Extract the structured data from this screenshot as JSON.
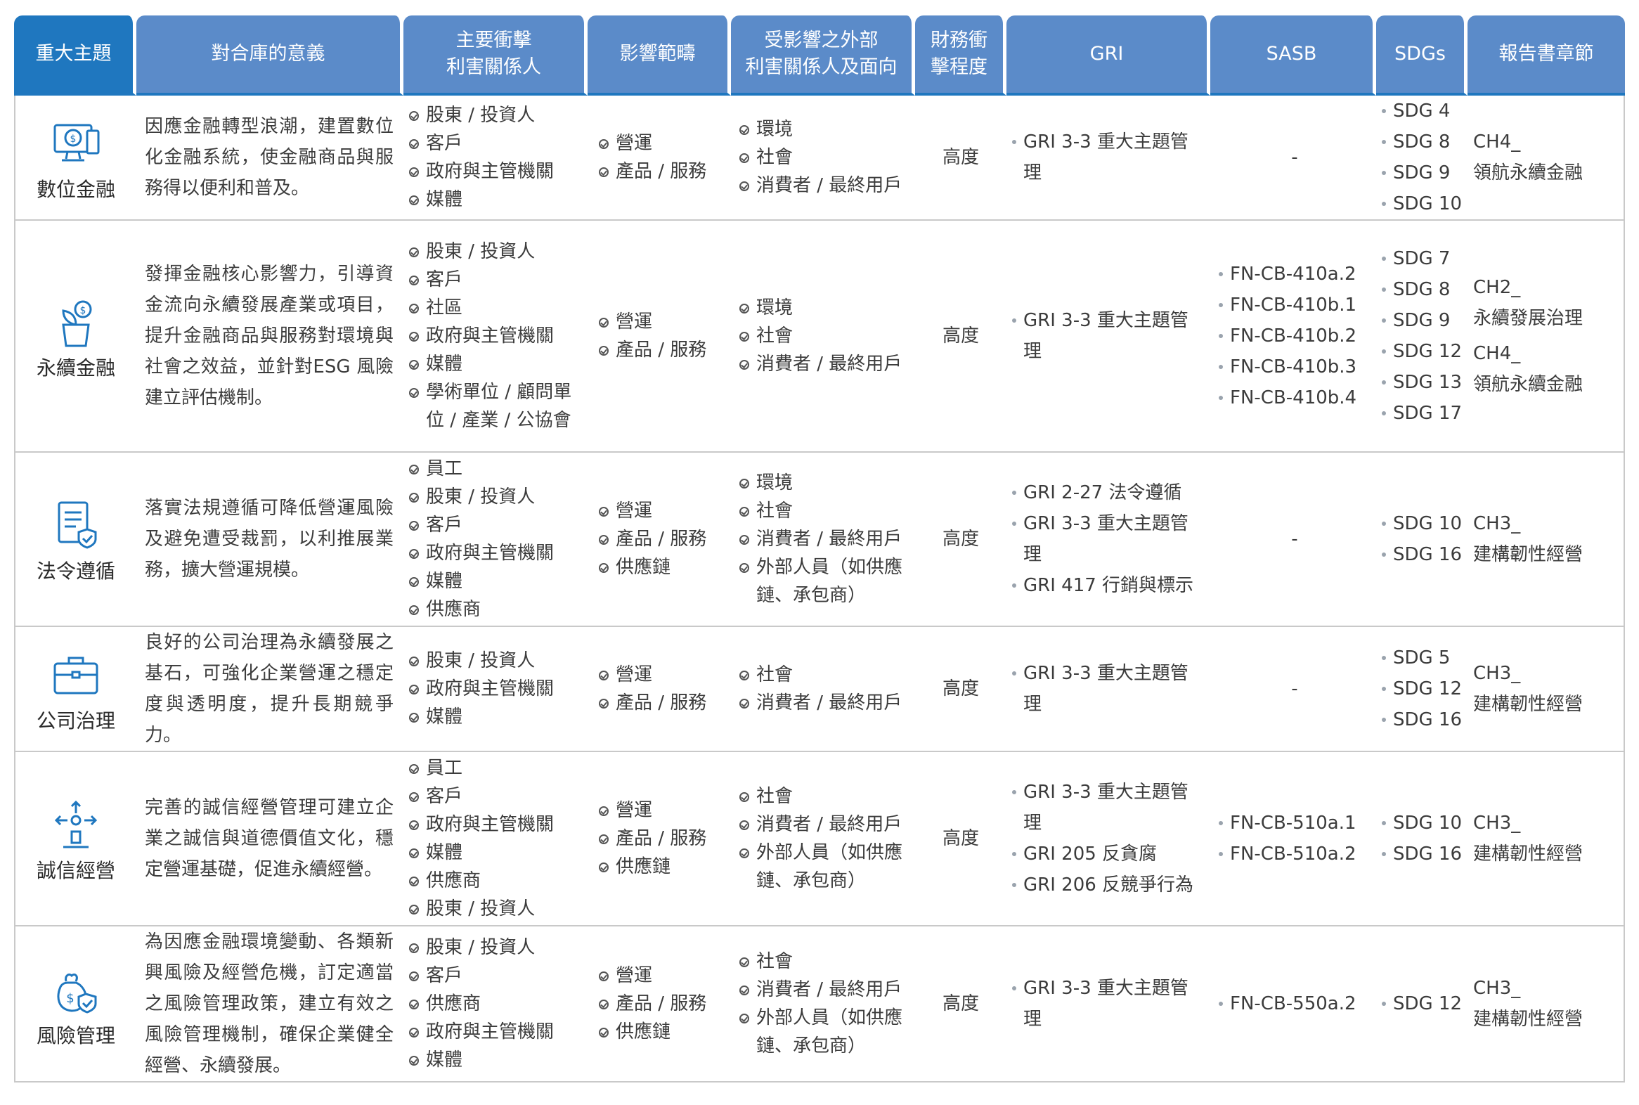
{
  "header": {
    "topic": "重大主題",
    "meaning": "對合庫的意義",
    "stakeholders": "主要衝擊\n利害關係人",
    "scope": "影響範疇",
    "external": "受影響之外部\n利害關係人及面向",
    "financial": "財務衝\n擊程度",
    "gri": "GRI",
    "sasb": "SASB",
    "sdgs": "SDGs",
    "chapter": "報告書章節"
  },
  "rows": [
    {
      "topic": "數位金融",
      "icon": "digital-finance-icon",
      "meaning": "因應金融轉型浪潮，建置數位化金融系統，使金融商品與服務得以便利和普及。",
      "stakeholders": [
        "股東 / 投資人",
        "客戶",
        "政府與主管機關",
        "媒體"
      ],
      "scope": [
        "營運",
        "產品 / 服務"
      ],
      "external": [
        "環境",
        "社會",
        "消費者 / 最終用戶"
      ],
      "financial": "高度",
      "gri": [
        "GRI 3-3 重大主題管理"
      ],
      "sasb_text": "-",
      "sasb": [],
      "sdgs": [
        "SDG 4",
        "SDG 8",
        "SDG 9",
        "SDG 10"
      ],
      "chapter": [
        "CH4_",
        "領航永續金融"
      ]
    },
    {
      "topic": "永續金融",
      "icon": "sustainable-finance-icon",
      "meaning": "發揮金融核心影響力，引導資金流向永續發展產業或項目，提升金融商品與服務對環境與社會之效益，並針對ESG 風險建立評估機制。",
      "stakeholders": [
        "股東 / 投資人",
        "客戶",
        "社區",
        "政府與主管機關",
        "媒體",
        "學術單位 / 顧問單位 / 產業 / 公協會"
      ],
      "scope": [
        "營運",
        "產品 / 服務"
      ],
      "external": [
        "環境",
        "社會",
        "消費者 / 最終用戶"
      ],
      "financial": "高度",
      "gri": [
        "GRI 3-3 重大主題管理"
      ],
      "sasb_text": "",
      "sasb": [
        "FN-CB-410a.2",
        "FN-CB-410b.1",
        "FN-CB-410b.2",
        "FN-CB-410b.3",
        "FN-CB-410b.4"
      ],
      "sdgs": [
        "SDG 7",
        "SDG 8",
        "SDG 9",
        "SDG 12",
        "SDG 13",
        "SDG 17"
      ],
      "chapter": [
        "CH2_",
        "永續發展治理",
        "CH4_",
        "領航永續金融"
      ]
    },
    {
      "topic": "法令遵循",
      "icon": "compliance-icon",
      "meaning": "落實法規遵循可降低營運風險及避免遭受裁罰，以利推展業務，擴大營運規模。",
      "stakeholders": [
        "員工",
        "股東 / 投資人",
        "客戶",
        "政府與主管機關",
        "媒體",
        "供應商"
      ],
      "scope": [
        "營運",
        "產品 / 服務",
        "供應鏈"
      ],
      "external": [
        "環境",
        "社會",
        "消費者 / 最終用戶",
        "外部人員（如供應鏈、承包商）"
      ],
      "financial": "高度",
      "gri": [
        "GRI 2-27 法令遵循",
        "GRI 3-3 重大主題管理",
        "GRI 417 行銷與標示"
      ],
      "sasb_text": "-",
      "sasb": [],
      "sdgs": [
        "SDG 10",
        "SDG 16"
      ],
      "chapter": [
        "CH3_",
        "建構韌性經營"
      ]
    },
    {
      "topic": "公司治理",
      "icon": "briefcase-icon",
      "meaning": "良好的公司治理為永續發展之基石，可強化企業營運之穩定度與透明度，提升長期競爭力。",
      "stakeholders": [
        "股東 / 投資人",
        "政府與主管機關",
        "媒體"
      ],
      "scope": [
        "營運",
        "產品 / 服務"
      ],
      "external": [
        "社會",
        "消費者 / 最終用戶"
      ],
      "financial": "高度",
      "gri": [
        "GRI 3-3 重大主題管理"
      ],
      "sasb_text": "-",
      "sasb": [],
      "sdgs": [
        "SDG 5",
        "SDG 12",
        "SDG 16"
      ],
      "chapter": [
        "CH3_",
        "建構韌性經營"
      ]
    },
    {
      "topic": "誠信經營",
      "icon": "integrity-icon",
      "meaning": "完善的誠信經營管理可建立企業之誠信與道德價值文化，穩定營運基礎，促進永續經營。",
      "stakeholders": [
        "員工",
        "客戶",
        "政府與主管機關",
        "媒體",
        "供應商",
        "股東 / 投資人"
      ],
      "scope": [
        "營運",
        "產品 / 服務",
        "供應鏈"
      ],
      "external": [
        "社會",
        "消費者 / 最終用戶",
        "外部人員（如供應鏈、承包商）"
      ],
      "financial": "高度",
      "gri": [
        "GRI 3-3 重大主題管理",
        "GRI 205 反貪腐",
        "GRI 206 反競爭行為"
      ],
      "sasb_text": "",
      "sasb": [
        "FN-CB-510a.1",
        "FN-CB-510a.2"
      ],
      "sdgs": [
        "SDG 10",
        "SDG 16"
      ],
      "chapter": [
        "CH3_",
        "建構韌性經營"
      ]
    },
    {
      "topic": "風險管理",
      "icon": "risk-management-icon",
      "meaning": "為因應金融環境變動、各類新興風險及經營危機，訂定適當之風險管理政策，建立有效之風險管理機制，確保企業健全經營、永續發展。",
      "stakeholders": [
        "股東 / 投資人",
        "客戶",
        "供應商",
        "政府與主管機關",
        "媒體"
      ],
      "scope": [
        "營運",
        "產品 / 服務",
        "供應鏈"
      ],
      "external": [
        "社會",
        "消費者 / 最終用戶",
        "外部人員（如供應鏈、承包商）"
      ],
      "financial": "高度",
      "gri": [
        "GRI 3-3 重大主題管理"
      ],
      "sasb_text": "",
      "sasb": [
        "FN-CB-550a.2"
      ],
      "sdgs": [
        "SDG 12"
      ],
      "chapter": [
        "CH3_",
        "建構韌性經營"
      ]
    }
  ],
  "colors": {
    "header_primary": "#1f77bf",
    "header": "#5b8bc9",
    "icon": "#1f77bf"
  }
}
